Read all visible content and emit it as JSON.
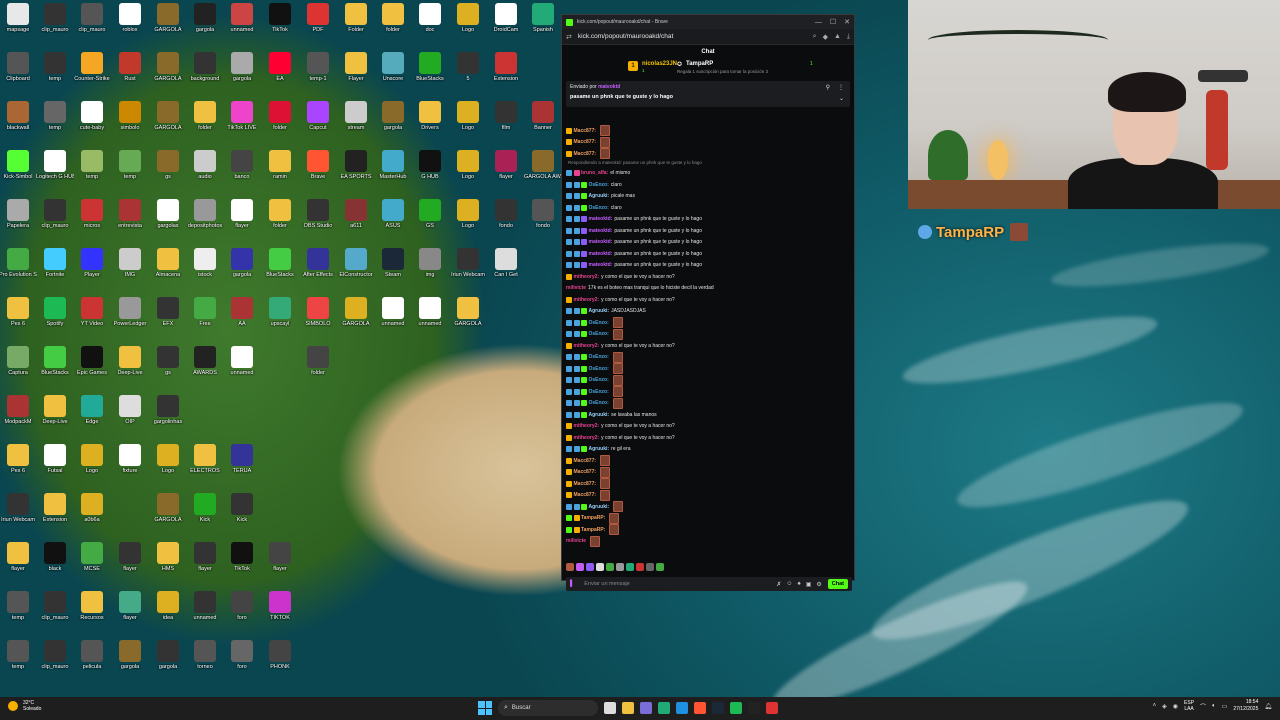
{
  "browser": {
    "tab_title": "kick.com/popout/maurooakd/chat - Brave",
    "url": "kick.com/popout/maurooakd/chat",
    "chat_header": "Chat",
    "leaderboard": {
      "top_name": "nicolas23JN",
      "top_count": "1",
      "second_name": "TampaRP",
      "second_count": "1",
      "subtitle": "Regala 1 suscripción para tomar la posición 3"
    },
    "pinned": {
      "sent_by_label": "Enviado por",
      "sent_by_user": "mateoktd",
      "message": "pasame un phnk que te guste y lo hago"
    },
    "input_placeholder": "Enviar un mensaje",
    "send_label": "Chat"
  },
  "messages": [
    {
      "user": "Macc877:",
      "color": "#f0a060",
      "text": "",
      "emote": true,
      "badges": [
        "gold"
      ]
    },
    {
      "user": "Macc877:",
      "color": "#f0a060",
      "text": "",
      "emote": true,
      "badges": [
        "gold"
      ]
    },
    {
      "user": "Macc877:",
      "color": "#f0a060",
      "text": "",
      "emote": true,
      "badges": [
        "gold"
      ]
    },
    {
      "reply": "Respondiendo a mateoktd: pasame un phnk que te guste y lo hago"
    },
    {
      "user": "bruno_alfa:",
      "color": "#e84393",
      "text": "el mismo",
      "emote": false,
      "badges": [
        "blue",
        "pink"
      ]
    },
    {
      "user": "OsEnzo:",
      "color": "#4aa3df",
      "text": "claro",
      "emote": false,
      "badges": [
        "blue",
        "blue",
        "green"
      ]
    },
    {
      "user": "Agruuki:",
      "color": "#9bd3ff",
      "text": "picale mas",
      "emote": false,
      "badges": [
        "blue",
        "blue",
        "green"
      ]
    },
    {
      "user": "OsEnzo:",
      "color": "#4aa3df",
      "text": "claro",
      "emote": false,
      "badges": [
        "blue",
        "blue",
        "green"
      ]
    },
    {
      "user": "mateoktd:",
      "color": "#c85cff",
      "text": "pasame un phnk que te guste y lo hago",
      "emote": false,
      "badges": [
        "blue",
        "blue",
        "purple"
      ]
    },
    {
      "user": "mateoktd:",
      "color": "#c85cff",
      "text": "pasame un phnk que te guste y lo hago",
      "emote": false,
      "badges": [
        "blue",
        "blue",
        "purple"
      ]
    },
    {
      "user": "mateoktd:",
      "color": "#c85cff",
      "text": "pasame un phnk que te guste y lo hago",
      "emote": false,
      "badges": [
        "blue",
        "blue",
        "purple"
      ]
    },
    {
      "user": "mateoktd:",
      "color": "#c85cff",
      "text": "pasame un phnk que te guste y lo hago",
      "emote": false,
      "badges": [
        "blue",
        "blue",
        "purple"
      ]
    },
    {
      "user": "mateoktd:",
      "color": "#c85cff",
      "text": "pasame un phnk que te guste y lo hago",
      "emote": false,
      "badges": [
        "blue",
        "blue",
        "purple"
      ]
    },
    {
      "user": "mitheory2:",
      "color": "#e84393",
      "text": "y como el que te voy a hacer no?",
      "emote": false,
      "badges": [
        "gold"
      ]
    },
    {
      "user": "milivicte",
      "color": "#e84393",
      "text": "17k es el boteo mas tranqui que lo hiciste decil la verdad",
      "emote": false,
      "badges": []
    },
    {
      "user": "mitheory2:",
      "color": "#e84393",
      "text": "y como el que te voy a hacer no?",
      "emote": false,
      "badges": [
        "gold"
      ]
    },
    {
      "user": "Agruuki:",
      "color": "#9bd3ff",
      "text": "JASDJASDJAS",
      "emote": false,
      "badges": [
        "blue",
        "blue",
        "green"
      ]
    },
    {
      "user": "OsEnzo:",
      "color": "#4aa3df",
      "text": "",
      "emote": true,
      "badges": [
        "blue",
        "blue",
        "green"
      ]
    },
    {
      "user": "OsEnzo:",
      "color": "#4aa3df",
      "text": "",
      "emote": true,
      "badges": [
        "blue",
        "blue",
        "green"
      ]
    },
    {
      "user": "mitheory2:",
      "color": "#e84393",
      "text": "y como el que te voy a hacer no?",
      "emote": false,
      "badges": [
        "gold"
      ]
    },
    {
      "user": "OsEnzo:",
      "color": "#4aa3df",
      "text": "",
      "emote": true,
      "badges": [
        "blue",
        "blue",
        "green"
      ]
    },
    {
      "user": "OsEnzo:",
      "color": "#4aa3df",
      "text": "",
      "emote": true,
      "badges": [
        "blue",
        "blue",
        "green"
      ]
    },
    {
      "user": "OsEnzo:",
      "color": "#4aa3df",
      "text": "",
      "emote": true,
      "badges": [
        "blue",
        "blue",
        "green"
      ]
    },
    {
      "user": "OsEnzo:",
      "color": "#4aa3df",
      "text": "",
      "emote": true,
      "badges": [
        "blue",
        "blue",
        "green"
      ]
    },
    {
      "user": "OsEnzo:",
      "color": "#4aa3df",
      "text": "",
      "emote": true,
      "badges": [
        "blue",
        "blue",
        "green"
      ]
    },
    {
      "user": "Agruuki:",
      "color": "#9bd3ff",
      "text": "se lavaba las manos",
      "emote": false,
      "badges": [
        "blue",
        "blue",
        "green"
      ]
    },
    {
      "user": "mitheory2:",
      "color": "#e84393",
      "text": "y como el que te voy a hacer no?",
      "emote": false,
      "badges": [
        "gold"
      ]
    },
    {
      "user": "mitheory2:",
      "color": "#e84393",
      "text": "y como el que te voy a hacer no?",
      "emote": false,
      "badges": [
        "gold"
      ]
    },
    {
      "user": "Agruuki:",
      "color": "#9bd3ff",
      "text": "re gil era",
      "emote": false,
      "badges": [
        "blue",
        "blue",
        "green"
      ]
    },
    {
      "user": "Macc877:",
      "color": "#f0a060",
      "text": "",
      "emote": true,
      "badges": [
        "gold"
      ]
    },
    {
      "user": "Macc877:",
      "color": "#f0a060",
      "text": "",
      "emote": true,
      "badges": [
        "gold"
      ]
    },
    {
      "user": "Macc877:",
      "color": "#f0a060",
      "text": "",
      "emote": true,
      "badges": [
        "gold"
      ]
    },
    {
      "user": "Macc877:",
      "color": "#f0a060",
      "text": "",
      "emote": true,
      "badges": [
        "gold"
      ]
    },
    {
      "user": "Agruuki:",
      "color": "#9bd3ff",
      "text": "",
      "emote": true,
      "badges": [
        "blue",
        "blue",
        "green"
      ]
    },
    {
      "user": "TampaRP:",
      "color": "#f0a060",
      "text": "",
      "emote": true,
      "badges": [
        "green",
        "gold"
      ]
    },
    {
      "user": "TampaRP:",
      "color": "#f0a060",
      "text": "",
      "emote": true,
      "badges": [
        "green",
        "gold"
      ]
    },
    {
      "user": "milivicte",
      "color": "#e84393",
      "text": "",
      "emote": true,
      "badges": []
    }
  ],
  "overlay": {
    "name": "TampaRP"
  },
  "taskbar": {
    "weather_temp": "32°C",
    "weather_desc": "Soleado",
    "search_label": "Buscar",
    "lang_1": "ESP",
    "lang_2": "LAA",
    "time": "18:54",
    "date": "27/12/2025"
  },
  "desktop_icons": [
    [
      "mapsage",
      "#e8e8e8"
    ],
    [
      "clip_mauro",
      "#333"
    ],
    [
      "clip_mauro",
      "#555"
    ],
    [
      "roblox",
      "#fff"
    ],
    [
      "GARGOLA",
      "#8a6a2a"
    ],
    [
      "gargola",
      "#222"
    ],
    [
      "unnamed",
      "#c44"
    ],
    [
      "TikTok",
      "#111"
    ],
    [
      "PDF",
      "#d33"
    ],
    [
      "Folder",
      "#f0c040"
    ],
    [
      "folder",
      "#f0c040"
    ],
    [
      "doc",
      "#fff"
    ],
    [
      "Logo",
      "#dcb020"
    ],
    [
      "DroidCam",
      "#fff"
    ],
    [
      "Spanish",
      "#2a7"
    ],
    [
      "Clipboard",
      "#555"
    ],
    [
      "temp",
      "#333"
    ],
    [
      "Counter-Strike",
      "#f5a623"
    ],
    [
      "Rust",
      "#c0392b"
    ],
    [
      "GARGOLA",
      "#8a6a2a"
    ],
    [
      "background",
      "#333"
    ],
    [
      "gargola",
      "#aaa"
    ],
    [
      "EA",
      "#f03"
    ],
    [
      "temp-1",
      "#555"
    ],
    [
      "Flayer",
      "#f0c040"
    ],
    [
      "Unscore",
      "#5ab"
    ],
    [
      "BlueStacks",
      "#2a2"
    ],
    [
      "5",
      "#333"
    ],
    [
      "Extension",
      "#c33"
    ],
    [
      "",
      ""
    ],
    [
      "blackwall",
      "#a63"
    ],
    [
      "temp",
      "#666"
    ],
    [
      "cute-baby",
      "#fff"
    ],
    [
      "simbolo",
      "#c80"
    ],
    [
      "GARGOLA",
      "#8a6a2a"
    ],
    [
      "folder",
      "#f0c040"
    ],
    [
      "TikTok LIVE",
      "#e4c"
    ],
    [
      "folder",
      "#d13"
    ],
    [
      "Capcut",
      "#a4f"
    ],
    [
      "stream",
      "#ccc"
    ],
    [
      "gargola",
      "#8a6a2a"
    ],
    [
      "Drivers",
      "#f0c040"
    ],
    [
      "Logo",
      "#dcb020"
    ],
    [
      "film",
      "#333"
    ],
    [
      "Banner",
      "#a33"
    ],
    [
      "Kick-Simbol",
      "#5f3"
    ],
    [
      "Logitech G HUB",
      "#fff"
    ],
    [
      "temp",
      "#9b6"
    ],
    [
      "temp",
      "#6a5"
    ],
    [
      "gs",
      "#8a6a2a"
    ],
    [
      "audio",
      "#ccc"
    ],
    [
      "banco",
      "#444"
    ],
    [
      "ramin",
      "#f0c040"
    ],
    [
      "Brave",
      "#f53"
    ],
    [
      "EA SPORTS",
      "#222"
    ],
    [
      "MasterHub",
      "#4ac"
    ],
    [
      "G HUB",
      "#111"
    ],
    [
      "Logo",
      "#dcb020"
    ],
    [
      "flayer",
      "#a25"
    ],
    [
      "GARGOLA AWARDS",
      "#8a6a2a"
    ],
    [
      "Papelera",
      "#aaa"
    ],
    [
      "clip_mauro",
      "#333"
    ],
    [
      "micros",
      "#c33"
    ],
    [
      "entrevista",
      "#a33"
    ],
    [
      "gargolas",
      "#fff"
    ],
    [
      "depositphotos",
      "#999"
    ],
    [
      "flayer",
      "#fff"
    ],
    [
      "folder",
      "#f0c040"
    ],
    [
      "OBS Studio",
      "#333"
    ],
    [
      "a611",
      "#833"
    ],
    [
      "ASUS",
      "#4ac"
    ],
    [
      "GS",
      "#2a2"
    ],
    [
      "Logo",
      "#dcb020"
    ],
    [
      "fondo",
      "#333"
    ],
    [
      "fondo",
      "#555"
    ],
    [
      "Pro Evolution Soccer",
      "#4a4"
    ],
    [
      "Fortnite",
      "#4cf"
    ],
    [
      "Player",
      "#33f"
    ],
    [
      "IMG",
      "#ccc"
    ],
    [
      "Almacena",
      "#f0c040"
    ],
    [
      "istock",
      "#eee"
    ],
    [
      "gargola",
      "#33a"
    ],
    [
      "BlueStacks",
      "#4c4"
    ],
    [
      "After Effects",
      "#339"
    ],
    [
      "ElConstructor",
      "#5ac"
    ],
    [
      "Steam",
      "#1b2838"
    ],
    [
      "img",
      "#888"
    ],
    [
      "Iriun Webcam",
      "#333"
    ],
    [
      "Can I Get",
      "#ddd"
    ],
    [
      "",
      ""
    ],
    [
      "Pes 6",
      "#f0c040"
    ],
    [
      "Spotify",
      "#1db954"
    ],
    [
      "YT Video",
      "#c33"
    ],
    [
      "PowerLedger",
      "#999"
    ],
    [
      "EFX",
      "#333"
    ],
    [
      "Free",
      "#4a4"
    ],
    [
      "AA",
      "#a33"
    ],
    [
      "upscayl",
      "#3a7"
    ],
    [
      "SIMBOLO",
      "#e44"
    ],
    [
      "GARGOLA",
      "#dcb020"
    ],
    [
      "unnamed",
      "#fff"
    ],
    [
      "unnamed",
      "#fff"
    ],
    [
      "GARGOLA",
      "#f0c040"
    ],
    [
      "",
      ""
    ],
    [
      "",
      ""
    ],
    [
      "Captura",
      "#7a6"
    ],
    [
      "BlueStacks",
      "#4c4"
    ],
    [
      "Epic Games",
      "#111"
    ],
    [
      "Deep-Live",
      "#f0c040"
    ],
    [
      "gs",
      "#333"
    ],
    [
      "AWARDS",
      "#222"
    ],
    [
      "unnamed",
      "#fff"
    ],
    [
      "",
      ""
    ],
    [
      "folder",
      "#444"
    ],
    [
      "",
      ""
    ],
    [
      "",
      ""
    ],
    [
      "",
      ""
    ],
    [
      "",
      ""
    ],
    [
      "",
      ""
    ],
    [
      "",
      ""
    ],
    [
      "ModpackM",
      "#a33"
    ],
    [
      "Deep-Live",
      "#f0c040"
    ],
    [
      "Edge",
      "#2a9"
    ],
    [
      "OIP",
      "#ddd"
    ],
    [
      "gargolinhas",
      "#333"
    ],
    [
      "",
      ""
    ],
    [
      "",
      ""
    ],
    [
      "",
      ""
    ],
    [
      "",
      ""
    ],
    [
      "",
      ""
    ],
    [
      "",
      ""
    ],
    [
      "",
      ""
    ],
    [
      "",
      ""
    ],
    [
      "",
      ""
    ],
    [
      "",
      ""
    ],
    [
      "Pes 6",
      "#f0c040"
    ],
    [
      "Futsal",
      "#fff"
    ],
    [
      "Logo",
      "#dcb020"
    ],
    [
      "fixture",
      "#fff"
    ],
    [
      "Logo",
      "#dcb020"
    ],
    [
      "ELECTROS",
      "#f0c040"
    ],
    [
      "TERUA",
      "#339"
    ],
    [
      "",
      ""
    ],
    [
      "",
      ""
    ],
    [
      "",
      ""
    ],
    [
      "",
      ""
    ],
    [
      "",
      ""
    ],
    [
      "",
      ""
    ],
    [
      "",
      ""
    ],
    [
      "",
      ""
    ],
    [
      "Iriun Webcam",
      "#333"
    ],
    [
      "Extension",
      "#f0c040"
    ],
    [
      "a0b6a",
      "#dcb020"
    ],
    [
      "",
      ""
    ],
    [
      "GARGOLA",
      "#8a6a2a"
    ],
    [
      "Kick",
      "#2a2"
    ],
    [
      "Kick",
      "#333"
    ],
    [
      "",
      ""
    ],
    [
      "",
      ""
    ],
    [
      "",
      ""
    ],
    [
      "",
      ""
    ],
    [
      "",
      ""
    ],
    [
      "",
      ""
    ],
    [
      "",
      ""
    ],
    [
      "",
      ""
    ],
    [
      "flayer",
      "#f0c040"
    ],
    [
      "black",
      "#111"
    ],
    [
      "MCSE",
      "#4a4"
    ],
    [
      "flayer",
      "#333"
    ],
    [
      "HMS",
      "#f0c040"
    ],
    [
      "flayer",
      "#333"
    ],
    [
      "TikTok",
      "#111"
    ],
    [
      "flayer",
      "#444"
    ],
    [
      "",
      ""
    ],
    [
      "",
      ""
    ],
    [
      "",
      ""
    ],
    [
      "",
      ""
    ],
    [
      "",
      ""
    ],
    [
      "",
      ""
    ],
    [
      "",
      ""
    ],
    [
      "temp",
      "#555"
    ],
    [
      "clip_mauro",
      "#333"
    ],
    [
      "Recursos",
      "#f0c040"
    ],
    [
      "flayer",
      "#4a8"
    ],
    [
      "idea",
      "#dcb020"
    ],
    [
      "unnamed",
      "#333"
    ],
    [
      "foro",
      "#444"
    ],
    [
      "TIKTOK",
      "#c3c"
    ],
    [
      "",
      ""
    ],
    [
      "",
      ""
    ],
    [
      "",
      ""
    ],
    [
      "",
      ""
    ],
    [
      "",
      ""
    ],
    [
      "",
      ""
    ],
    [
      "",
      ""
    ],
    [
      "temp",
      "#555"
    ],
    [
      "clip_mauro",
      "#333"
    ],
    [
      "pelicula",
      "#555"
    ],
    [
      "gargola",
      "#8a6a2a"
    ],
    [
      "gargola",
      "#333"
    ],
    [
      "torneo",
      "#555"
    ],
    [
      "foro",
      "#666"
    ],
    [
      "PHONK",
      "#444"
    ],
    [
      "",
      ""
    ],
    [
      "",
      ""
    ],
    [
      "",
      ""
    ],
    [
      "",
      ""
    ],
    [
      "",
      ""
    ],
    [
      "",
      ""
    ],
    [
      "",
      ""
    ]
  ]
}
